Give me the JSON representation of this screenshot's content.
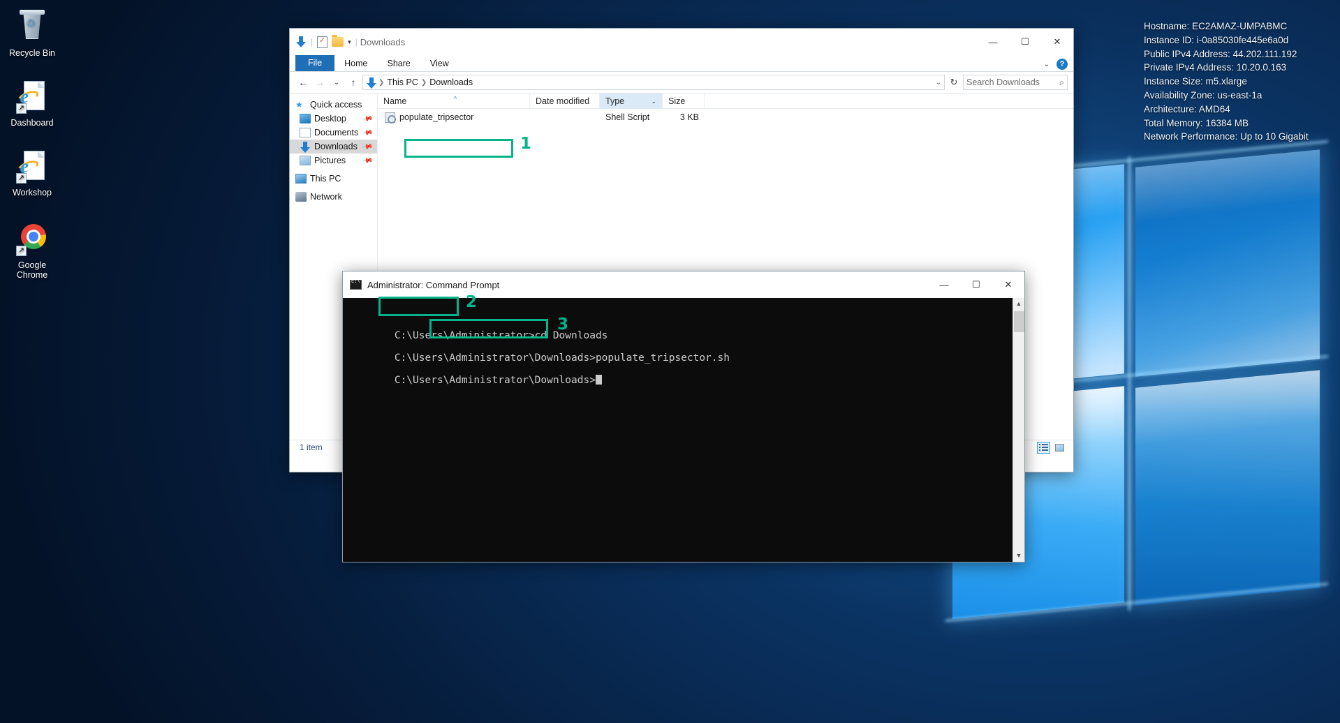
{
  "instance_info": {
    "lines": [
      "Hostname: EC2AMAZ-UMPABMC",
      "Instance ID: i-0a85030fe445e6a0d",
      "Public IPv4 Address: 44.202.111.192",
      "Private IPv4 Address: 10.20.0.163",
      "Instance Size: m5.xlarge",
      "Availability Zone: us-east-1a",
      "Architecture: AMD64",
      "Total Memory: 16384 MB",
      "Network Performance: Up to 10 Gigabit"
    ]
  },
  "desktop": {
    "icons": [
      {
        "label": "Recycle Bin",
        "icon": "recycle-bin-icon"
      },
      {
        "label": "Dashboard",
        "icon": "internet-explorer-shortcut-icon"
      },
      {
        "label": "Workshop",
        "icon": "internet-explorer-shortcut-icon"
      },
      {
        "label": "Google Chrome",
        "icon": "google-chrome-shortcut-icon"
      }
    ]
  },
  "explorer": {
    "window_title": "Downloads",
    "quick_access_toolbar": [
      {
        "name": "downloads-arrow-icon"
      },
      {
        "name": "properties-icon"
      },
      {
        "name": "new-folder-icon"
      },
      {
        "name": "customize-qat-chevron-icon"
      }
    ],
    "ribbon_tabs": [
      {
        "label": "File"
      },
      {
        "label": "Home"
      },
      {
        "label": "Share"
      },
      {
        "label": "View"
      }
    ],
    "nav": {
      "back": "←",
      "forward": "→",
      "recent": "⌄",
      "up": "↑"
    },
    "breadcrumb": [
      "This PC",
      "Downloads"
    ],
    "search": {
      "placeholder": "Search Downloads"
    },
    "nav_pane": [
      {
        "label": "Quick access",
        "icon": "star-icon",
        "pinned": false,
        "selected": false,
        "indent": 0
      },
      {
        "label": "Desktop",
        "icon": "desktop-icon",
        "pinned": true,
        "selected": false,
        "indent": 1
      },
      {
        "label": "Documents",
        "icon": "documents-icon",
        "pinned": true,
        "selected": false,
        "indent": 1
      },
      {
        "label": "Downloads",
        "icon": "downloads-icon",
        "pinned": true,
        "selected": true,
        "indent": 1
      },
      {
        "label": "Pictures",
        "icon": "pictures-icon",
        "pinned": true,
        "selected": false,
        "indent": 1
      },
      {
        "label": "This PC",
        "icon": "this-pc-icon",
        "pinned": false,
        "selected": false,
        "indent": 0
      },
      {
        "label": "Network",
        "icon": "network-icon",
        "pinned": false,
        "selected": false,
        "indent": 0
      }
    ],
    "columns": [
      {
        "label": "Name",
        "sorted": true
      },
      {
        "label": "Date modified",
        "sorted": false
      },
      {
        "label": "Type",
        "sorted": false,
        "highlighted": true
      },
      {
        "label": "Size",
        "sorted": false
      }
    ],
    "files": [
      {
        "name": "populate_tripsector",
        "date_modified": "",
        "type": "Shell Script",
        "size": "3 KB"
      }
    ],
    "status": "1 item",
    "view_buttons": [
      {
        "name": "details-view-button",
        "active": true
      },
      {
        "name": "large-icons-view-button",
        "active": false
      }
    ]
  },
  "command_prompt": {
    "window_title": "Administrator: Command Prompt",
    "lines": [
      {
        "prompt": "C:\\Users\\Administrator>",
        "command": "cd Downloads"
      },
      {
        "prompt": "C:\\Users\\Administrator\\Downloads>",
        "command": "populate_tripsector.sh"
      },
      {
        "prompt": "C:\\Users\\Administrator\\Downloads>",
        "command": ""
      }
    ]
  },
  "annotations": {
    "color": "#05b489",
    "markers": [
      {
        "number": "1",
        "target": "file-populate-tripsector"
      },
      {
        "number": "2",
        "target": "command-cd-downloads"
      },
      {
        "number": "3",
        "target": "command-populate-tripsector-sh"
      }
    ]
  },
  "window_controls": {
    "minimize": "—",
    "maximize": "☐",
    "close": "✕"
  }
}
